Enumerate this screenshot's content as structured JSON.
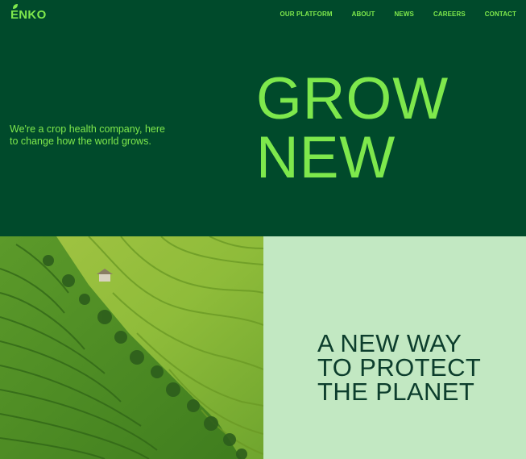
{
  "brand": {
    "name": "ENKO",
    "color": "#7ee84c"
  },
  "nav": {
    "items": [
      {
        "label": "OUR PLATFORM"
      },
      {
        "label": "ABOUT"
      },
      {
        "label": "NEWS"
      },
      {
        "label": "CAREERS"
      },
      {
        "label": "CONTACT"
      }
    ]
  },
  "hero": {
    "tagline": "We're a crop health company, here to change how the world grows.",
    "headline_line1": "GROW",
    "headline_line2": "NEW",
    "background": "#004a2b"
  },
  "feature": {
    "image": "aerial-rice-terraces-photo",
    "title_line1": "A NEW WAY",
    "title_line2": "TO PROTECT",
    "title_line3": "THE PLANET",
    "background": "#c2e8c2",
    "text_color": "#0c3d2c"
  }
}
